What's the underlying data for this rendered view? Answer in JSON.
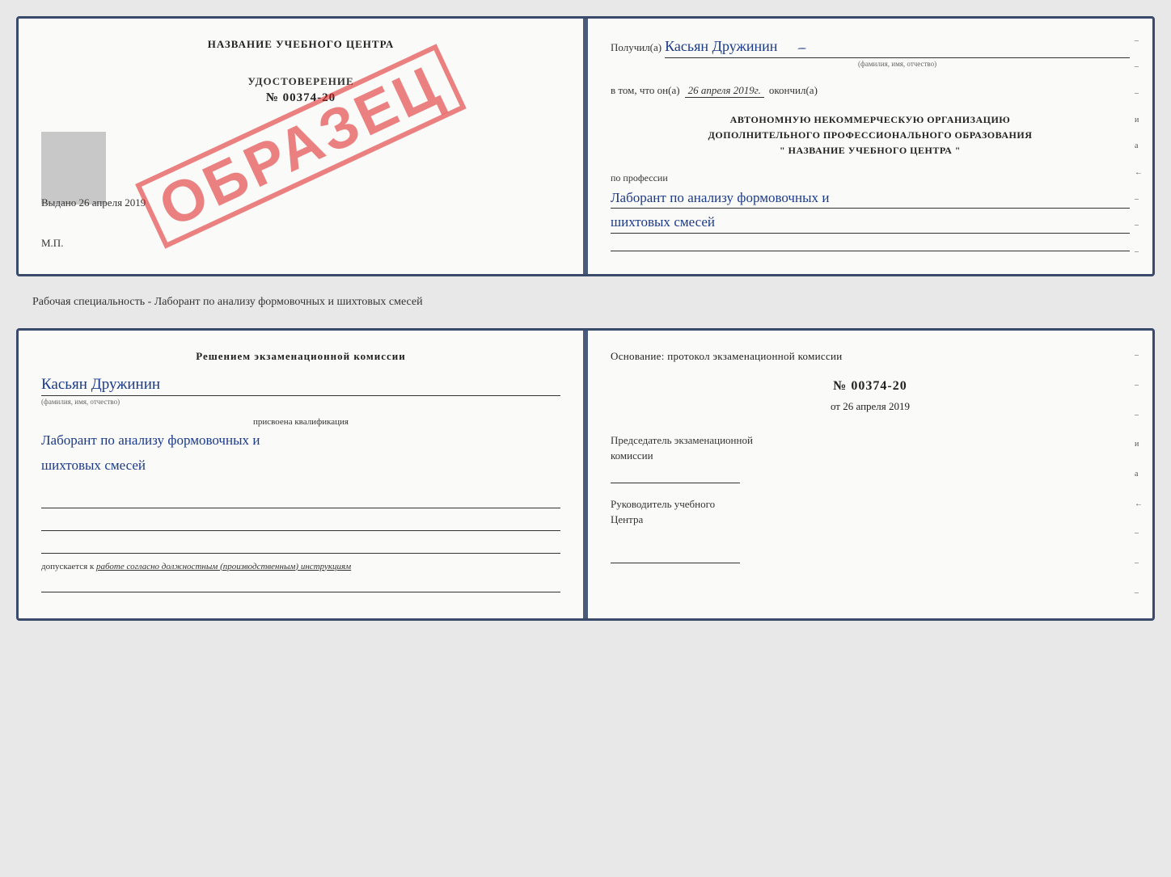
{
  "top_cert": {
    "left": {
      "title": "НАЗВАНИЕ УЧЕБНОГО ЦЕНТРА",
      "udost_label": "УДОСТОВЕРЕНИЕ",
      "udost_number": "№ 00374-20",
      "vydano_label": "Выдано",
      "vydano_date": "26 апреля 2019",
      "mp_label": "М.П.",
      "stamp_text": "ОБРАЗЕЦ"
    },
    "right": {
      "poluchil_label": "Получил(a)",
      "poluchil_name": "Касьян Дружинин",
      "fio_subtitle": "(фамилия, имя, отчество)",
      "vtom_prefix": "в том, что он(а)",
      "vtom_date": "26 апреля 2019г.",
      "okonchil_label": "окончил(а)",
      "avt_line1": "АВТОНОМНУЮ НЕКОММЕРЧЕСКУЮ ОРГАНИЗАЦИЮ",
      "avt_line2": "ДОПОЛНИТЕЛЬНОГО ПРОФЕССИОНАЛЬНОГО ОБРАЗОВАНИЯ",
      "avt_name": "\" НАЗВАНИЕ УЧЕБНОГО ЦЕНТРА \"",
      "po_professii": "по профессии",
      "professiya_line1": "Лаборант по анализу формовочных и",
      "professiya_line2": "шихтовых смесей",
      "right_labels": [
        "–",
        "–",
        "–",
        "и",
        "а",
        "←",
        "–",
        "–",
        "–"
      ]
    }
  },
  "separator": {
    "text": "Рабочая специальность - Лаборант по анализу формовочных и шихтовых смесей"
  },
  "bottom_cert": {
    "left": {
      "resheniem_title": "Решением экзаменационной комиссии",
      "kasyan_name": "Касьян Дружинин",
      "fio_subtitle": "(фамилия, имя, отчество)",
      "prisvoena_label": "присвоена квалификация",
      "kvali_line1": "Лаборант по анализу формовочных и",
      "kvali_line2": "шихтовых смесей",
      "dopuskaetsya_prefix": "допускается к",
      "dopusk_text": "работе согласно должностным (производственным) инструкциям"
    },
    "right": {
      "osnovanie_title": "Основание: протокол экзаменационной комиссии",
      "protokol_number": "№ 00374-20",
      "ot_label": "от",
      "ot_date": "26 апреля 2019",
      "predsedatel_line1": "Председатель экзаменационной",
      "predsedatel_line2": "комиссии",
      "rukovoditel_line1": "Руководитель учебного",
      "rukovoditel_line2": "Центра",
      "right_labels": [
        "–",
        "–",
        "–",
        "и",
        "а",
        "←",
        "–",
        "–",
        "–"
      ]
    }
  }
}
